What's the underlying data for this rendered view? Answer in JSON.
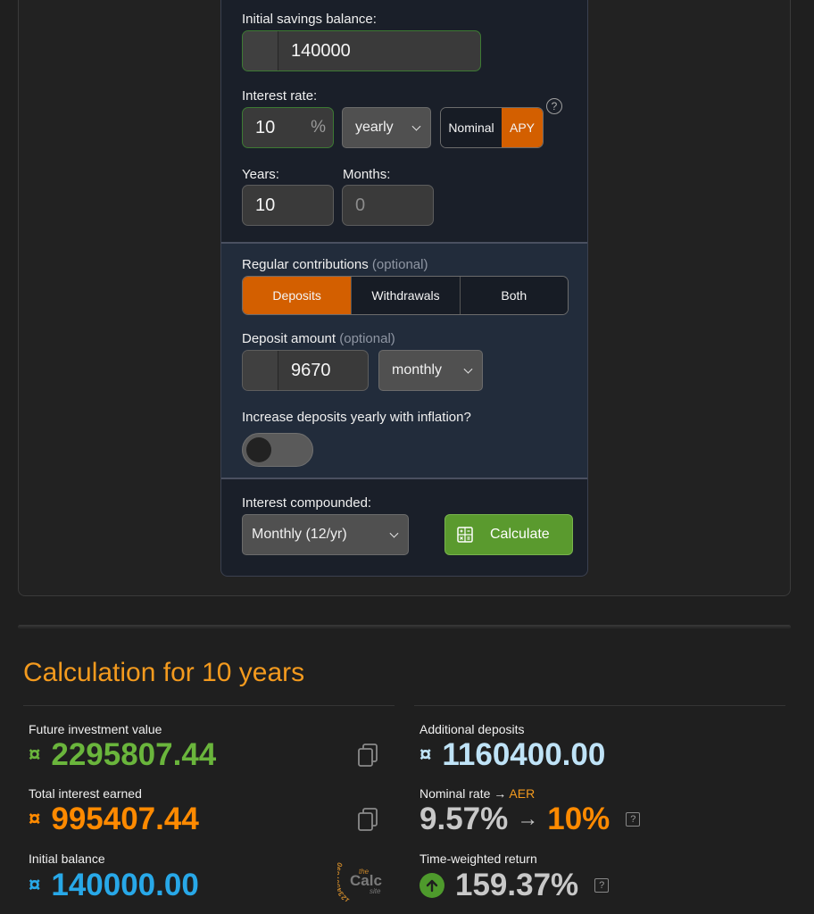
{
  "form": {
    "initial_label": "Initial savings balance:",
    "initial_value": "140000",
    "interest_label": "Interest rate:",
    "interest_value": "10",
    "percent_sign": "%",
    "interest_period": "yearly",
    "rate_type_options": [
      "Nominal",
      "APY"
    ],
    "rate_type_selected": "APY",
    "help": "?",
    "years_label": "Years:",
    "years_value": "10",
    "months_label": "Months:",
    "months_placeholder": "0"
  },
  "contributions": {
    "label": "Regular contributions",
    "optional": "(optional)",
    "tabs": [
      "Deposits",
      "Withdrawals",
      "Both"
    ],
    "active_tab": "Deposits",
    "deposit_label": "Deposit amount",
    "deposit_optional": "(optional)",
    "deposit_value": "9670",
    "deposit_period": "monthly",
    "inflation_label": "Increase deposits yearly with inflation?",
    "inflation_on": false
  },
  "compounding": {
    "label": "Interest compounded:",
    "value": "Monthly (12/yr)",
    "calculate_label": "Calculate"
  },
  "results": {
    "title": "Calculation for 10 years",
    "currency_symbol": "¤",
    "future_value_label": "Future investment value",
    "future_value": "2295807.44",
    "interest_label": "Total interest earned",
    "interest_value": "995407.44",
    "initial_label": "Initial balance",
    "initial_value": "140000.00",
    "additional_label": "Additional deposits",
    "additional_value": "1160400.00",
    "rate_label_prefix": "Nominal rate →",
    "rate_label_suffix": "AER",
    "nominal_rate": "9.57%",
    "arrow": "→",
    "aer_rate": "10%",
    "twr_label": "Time-weighted return",
    "twr_value": "159.37%",
    "help": "?"
  },
  "logo": {
    "digits": "1234567890",
    "the": "the",
    "calc": "Calc",
    "site": "site"
  },
  "colors": {
    "accent_orange": "#d35f00",
    "title_orange": "#f39a1e",
    "green_value": "#6ab53c",
    "orange_value": "#ff8a00",
    "blue_value": "#28a8e8",
    "light_blue_value": "#bfe3f7",
    "button_green": "#5a9a2e"
  }
}
